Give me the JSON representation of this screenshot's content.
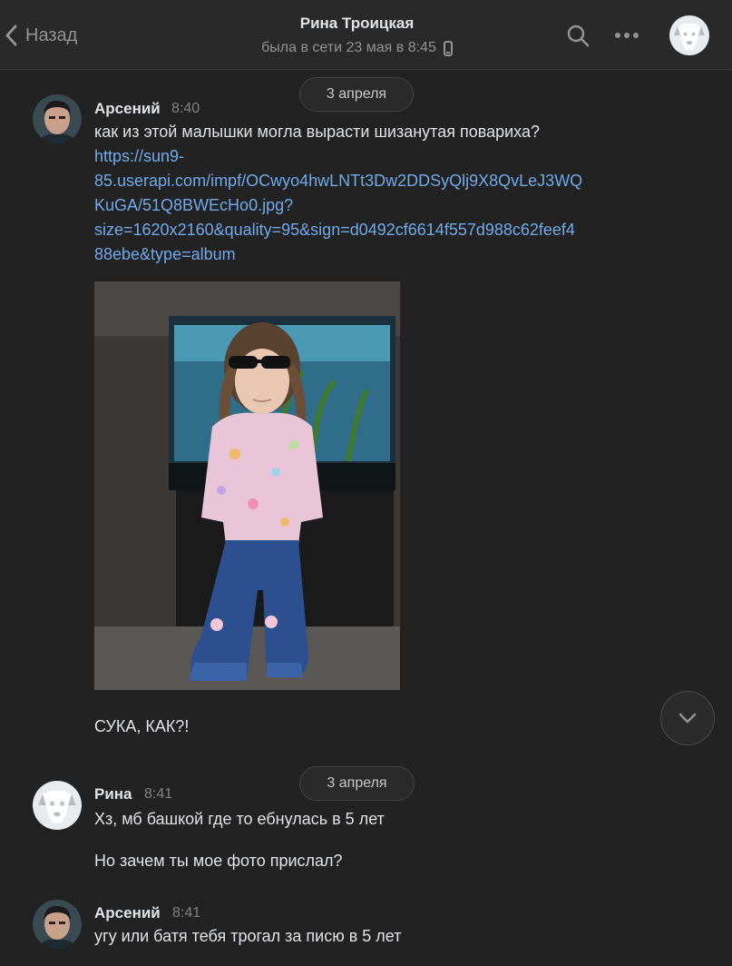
{
  "header": {
    "back_label": "Назад",
    "peer_name": "Рина Троицкая",
    "peer_status": "была в сети 23 мая в 8:45"
  },
  "icons": {
    "back": "chevron-left-icon",
    "search": "search-icon",
    "more": "more-dots-icon",
    "device": "mobile-phone-icon",
    "scroll": "chevron-down-icon"
  },
  "colors": {
    "link": "#71aaeb",
    "background": "#222222",
    "header": "#292929"
  },
  "messages": [
    {
      "date_divider": "3 апреля",
      "author": "Арсений",
      "time": "8:40",
      "text": "как из этой малышки могла вырасти шизанутая повариха?",
      "link_lines": [
        "https://sun9-",
        "85.userapi.com/impf/OCwyo4hwLNTt3Dw2DDSyQlj9X8QvLeJ3WQ",
        "KuGA/51Q8BWEcHo0.jpg?",
        "size=1620x2160&quality=95&sign=d0492cf6614f557d988c62feef4",
        "88ebe&type=album"
      ],
      "followup": "СУКА, КАК?!"
    },
    {
      "date_divider": "3 апреля",
      "author": "Рина",
      "time": "8:41",
      "text": "Хз, мб башкой где то ебнулась в 5 лет",
      "followup": "Но зачем ты мое фото прислал?"
    },
    {
      "author": "Арсений",
      "time": "8:41",
      "text": "угу или батя тебя трогал за писю в 5 лет"
    }
  ]
}
